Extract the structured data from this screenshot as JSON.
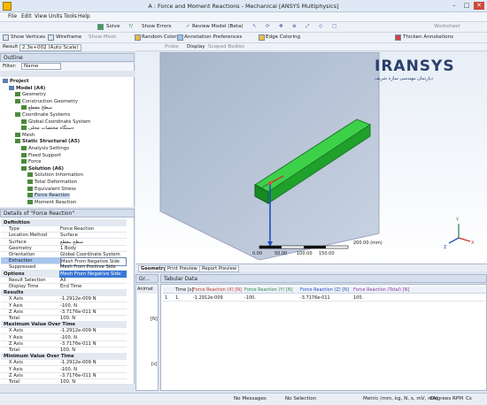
{
  "window": {
    "title": "A : Force and Moment Reactions - Mechanical [ANSYS Multiphysics]",
    "minimize": "–",
    "maximize": "□",
    "close": "✕"
  },
  "menu": [
    "File",
    "Edit",
    "View",
    "Units",
    "Tools",
    "Help"
  ],
  "toolbar1": {
    "solve": "Solve",
    "show_errors": "Show Errors",
    "review": "Review Model (Beta)",
    "worksheet": "Worksheet"
  },
  "toolbar2": {
    "show_vertices": "Show Vertices",
    "wireframe": "Wireframe",
    "show_mesh": "Show Mesh",
    "random_colors": "Random Colors",
    "annotation_prefs": "Annotation Preferences",
    "edge_coloring": "Edge Coloring",
    "thicken": "Thicken Annotations"
  },
  "toolbar3": {
    "result": "Result",
    "scale": "2.3e+002 (Auto Scale)",
    "probe": "Probe",
    "display": "Display",
    "scoped": "Scoped Bodies"
  },
  "outline": {
    "title": "Outline",
    "filter_label": "Filter:",
    "filter_value": "Name",
    "items": [
      {
        "label": "Project",
        "level": 0
      },
      {
        "label": "Model (A4)",
        "level": 1
      },
      {
        "label": "Geometry",
        "level": 2
      },
      {
        "label": "Construction Geometry",
        "level": 2
      },
      {
        "label": "سطح مقطع",
        "level": 3
      },
      {
        "label": "Coordinate Systems",
        "level": 2
      },
      {
        "label": "Global Coordinate System",
        "level": 3
      },
      {
        "label": "دستگاه مختصات محلی",
        "level": 3
      },
      {
        "label": "Mesh",
        "level": 2
      },
      {
        "label": "Static Structural (A5)",
        "level": 2
      },
      {
        "label": "Analysis Settings",
        "level": 3
      },
      {
        "label": "Fixed Support",
        "level": 3
      },
      {
        "label": "Force",
        "level": 3
      },
      {
        "label": "Solution (A6)",
        "level": 3
      },
      {
        "label": "Solution Information",
        "level": 4
      },
      {
        "label": "Total Deformation",
        "level": 4
      },
      {
        "label": "Equivalent Stress",
        "level": 4
      },
      {
        "label": "Force Reaction",
        "level": 4
      },
      {
        "label": "Moment Reaction",
        "level": 4
      }
    ]
  },
  "details": {
    "title": "Details of \"Force Reaction\"",
    "rows": [
      {
        "g": "Definition"
      },
      {
        "k": "Type",
        "v": "Force Reaction"
      },
      {
        "k": "Location Method",
        "v": "Surface"
      },
      {
        "k": "Surface",
        "v": "سطح مقطع"
      },
      {
        "k": "Geometry",
        "v": "1 Body"
      },
      {
        "k": "Orientation",
        "v": "Global Coordinate System"
      },
      {
        "k": "Extraction",
        "v": "Mesh From Negative Side",
        "sel": true
      },
      {
        "k": "Suppressed",
        "v": "Mesh From Positive Side"
      },
      {
        "g": "Options",
        "v": "Mesh From Negative Side",
        "hl": true
      },
      {
        "k": "Result Selection",
        "v": "All"
      },
      {
        "k": "Display Time",
        "v": "End Time"
      },
      {
        "g": "Results"
      },
      {
        "k": "X Axis",
        "v": "-1.2912e-009 N"
      },
      {
        "k": "Y Axis",
        "v": "-100. N"
      },
      {
        "k": "Z Axis",
        "v": "-3.7176e-011 N"
      },
      {
        "k": "Total",
        "v": "100. N"
      },
      {
        "g": "Maximum Value Over Time"
      },
      {
        "k": "X Axis",
        "v": "-1.2912e-009 N"
      },
      {
        "k": "Y Axis",
        "v": "-100. N"
      },
      {
        "k": "Z Axis",
        "v": "-3.7176e-011 N"
      },
      {
        "k": "Total",
        "v": "100. N"
      },
      {
        "g": "Minimum Value Over Time"
      },
      {
        "k": "X Axis",
        "v": "-1.2912e-009 N"
      },
      {
        "k": "Y Axis",
        "v": "-100. N"
      },
      {
        "k": "Z Axis",
        "v": "-3.7176e-011 N"
      },
      {
        "k": "Total",
        "v": "100. N"
      }
    ]
  },
  "viewport": {
    "logo": "IRANSYS",
    "logo_sub": "دپارتمان مهندسی سازه شریف",
    "scale_unit": "200.00 (mm)",
    "scale_labels": [
      "0.00",
      "50.00",
      "100.00",
      "150.00"
    ]
  },
  "bottom_tabs": [
    "Geometry",
    "Print Preview",
    "Report Preview"
  ],
  "graph": {
    "title": "Gr...",
    "animat": "Animat",
    "yunit": "[N]",
    "xunit": "[s]"
  },
  "tabular": {
    "title": "Tabular Data",
    "headers": [
      "Time [s]",
      "Force Reaction (X) [N]",
      "Force Reaction (Y) [N]",
      "Force Reaction (Z) [N]",
      "Force Reaction (Total) [N]"
    ],
    "row": [
      "1",
      "1.",
      "-1.2912e-009",
      "-100.",
      "-3.7176e-011",
      "100."
    ],
    "colors": [
      "#c0392b",
      "#2e8b57",
      "#1f4fc0",
      "#8e3aa0"
    ]
  },
  "status": {
    "messages": "No Messages",
    "selection": "No Selection",
    "units": "Metric (mm, kg, N, s, mV, mA)",
    "degrees": "Degrees",
    "rpm": "RPM",
    "celsius": "Cs"
  }
}
